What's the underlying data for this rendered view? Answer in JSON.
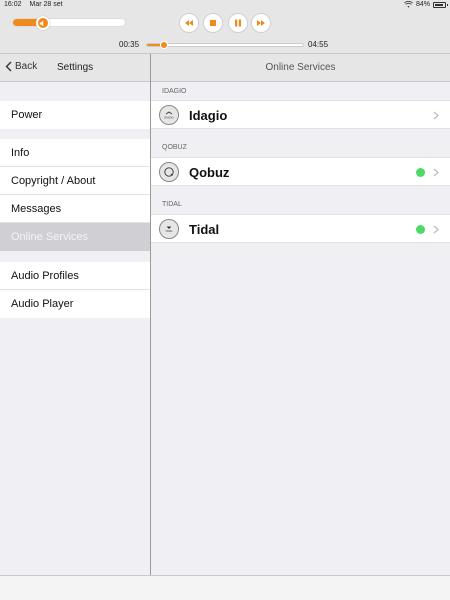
{
  "status_bar": {
    "time": "16:02",
    "date": "Mar 28 set",
    "battery": "84%"
  },
  "player": {
    "volume_level": 0.26,
    "elapsed": "00:35",
    "total": "04:55",
    "progress": 0.11,
    "accent_color": "#f08a1c",
    "controls": [
      "previous-icon",
      "stop-icon",
      "pause-icon",
      "next-icon"
    ]
  },
  "nav": {
    "back_label": "Back",
    "left_title": "Settings",
    "right_title": "Online Services"
  },
  "sidebar": {
    "groups": [
      [
        {
          "label": "Power"
        }
      ],
      [
        {
          "label": "Info"
        },
        {
          "label": "Copyright / About"
        },
        {
          "label": "Messages"
        },
        {
          "label": "Online Services",
          "selected": true
        }
      ],
      [
        {
          "label": "Audio Profiles"
        },
        {
          "label": "Audio Player"
        }
      ]
    ]
  },
  "services": [
    {
      "header": "IDAGIO",
      "name": "Idagio",
      "logo_text": "IDAGIO",
      "connected": false
    },
    {
      "header": "QOBUZ",
      "name": "Qobuz",
      "logo_text": "",
      "connected": true
    },
    {
      "header": "TIDAL",
      "name": "Tidal",
      "logo_text": "TIDAL",
      "connected": true
    }
  ],
  "colors": {
    "connected": "#4cd964",
    "selected_row": "#cfcfd4"
  }
}
